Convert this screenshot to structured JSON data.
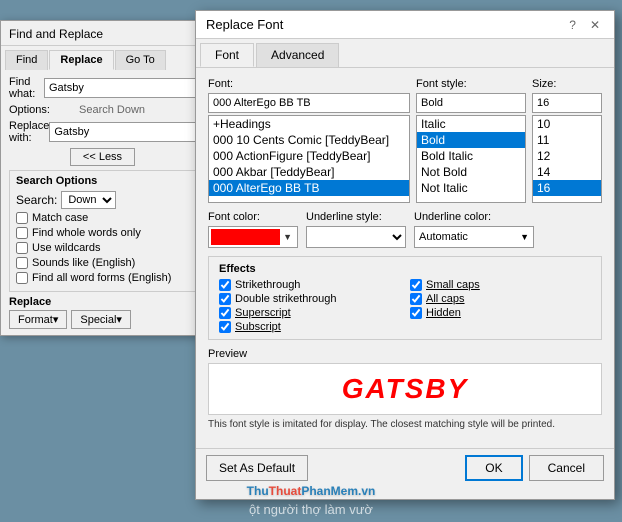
{
  "find_replace": {
    "title": "Find and Replace",
    "tabs": [
      "Find",
      "Replace",
      "Go To"
    ],
    "active_tab": "Replace",
    "find_label": "Find what:",
    "find_value": "Gatsby",
    "options_label": "Options:",
    "options_value": "Search Down",
    "replace_label": "Replace with:",
    "replace_value": "Gatsby",
    "less_button": "<< Less",
    "search_options_title": "Search Options",
    "search_label": "Search:",
    "search_value": "Down",
    "checkboxes": [
      {
        "label": "Match case",
        "checked": false
      },
      {
        "label": "Find whole words only",
        "checked": false
      },
      {
        "label": "Use wildcards",
        "checked": false
      },
      {
        "label": "Sounds like (English)",
        "checked": false
      },
      {
        "label": "Find all word forms (English)",
        "checked": false
      }
    ],
    "replace_section_title": "Replace",
    "format_button": "Format▾",
    "special_button": "Special▾"
  },
  "replace_font": {
    "title": "Replace Font",
    "help_icon": "?",
    "close_icon": "✕",
    "tabs": [
      "Font",
      "Advanced"
    ],
    "active_tab": "Font",
    "font_label": "Font:",
    "font_value": "000 AlterEgo BB TB",
    "font_list": [
      "+Headings",
      "000 10 Cents Comic [TeddyBear]",
      "000 ActionFigure [TeddyBear]",
      "000 Akbar [TeddyBear]",
      "000 AlterEgo BB TB"
    ],
    "font_selected": "000 AlterEgo BB TB",
    "style_label": "Font style:",
    "style_value": "Bold",
    "style_list": [
      "Italic",
      "Bold",
      "Bold Italic",
      "Not Bold",
      "Not Italic"
    ],
    "style_selected": "Bold",
    "size_label": "Size:",
    "size_value": "16",
    "size_list": [
      "10",
      "11",
      "12",
      "14",
      "16"
    ],
    "size_selected": "16",
    "color_label": "Font color:",
    "color_value": "#ff0000",
    "underline_style_label": "Underline style:",
    "underline_style_value": "",
    "underline_color_label": "Underline color:",
    "underline_color_value": "Automatic",
    "effects_title": "Effects",
    "effects": [
      {
        "label": "Strikethrough",
        "checked": true,
        "col": 1
      },
      {
        "label": "Small caps",
        "checked": true,
        "col": 2
      },
      {
        "label": "Double strikethrough",
        "checked": true,
        "col": 1
      },
      {
        "label": "All caps",
        "checked": true,
        "col": 2
      },
      {
        "label": "Superscript",
        "checked": true,
        "col": 1
      },
      {
        "label": "Hidden",
        "checked": true,
        "col": 2
      },
      {
        "label": "Subscript",
        "checked": true,
        "col": 1
      }
    ],
    "preview_label": "Preview",
    "preview_text": "GATSBY",
    "preview_note": "This font style is imitated for display. The closest matching style will be printed.",
    "set_default_label": "Set As Default",
    "ok_label": "OK",
    "cancel_label": "Cancel"
  },
  "watermark": {
    "text": "ThuThuatPhanMem.vn"
  },
  "bg_text": "ột người thợ làm vườ"
}
